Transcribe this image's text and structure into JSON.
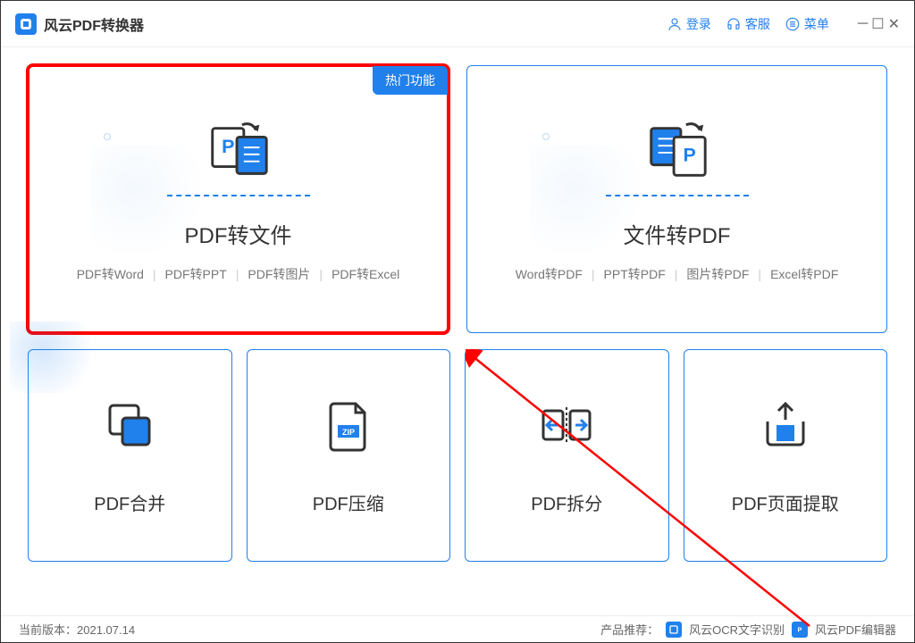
{
  "titlebar": {
    "app_title": "风云PDF转换器",
    "login_label": "登录",
    "support_label": "客服",
    "menu_label": "菜单"
  },
  "cards": {
    "pdf_to_file": {
      "title": "PDF转文件",
      "hot_badge": "热门功能",
      "sub": [
        "PDF转Word",
        "PDF转PPT",
        "PDF转图片",
        "PDF转Excel"
      ]
    },
    "file_to_pdf": {
      "title": "文件转PDF",
      "sub": [
        "Word转PDF",
        "PPT转PDF",
        "图片转PDF",
        "Excel转PDF"
      ]
    },
    "merge": {
      "title": "PDF合并"
    },
    "compress": {
      "title": "PDF压缩"
    },
    "split": {
      "title": "PDF拆分"
    },
    "extract": {
      "title": "PDF页面提取"
    }
  },
  "footer": {
    "version_label": "当前版本：",
    "version_value": "2021.07.14",
    "promo_label": "产品推荐：",
    "promo1": "风云OCR文字识别",
    "promo2": "风云PDF编辑器"
  }
}
